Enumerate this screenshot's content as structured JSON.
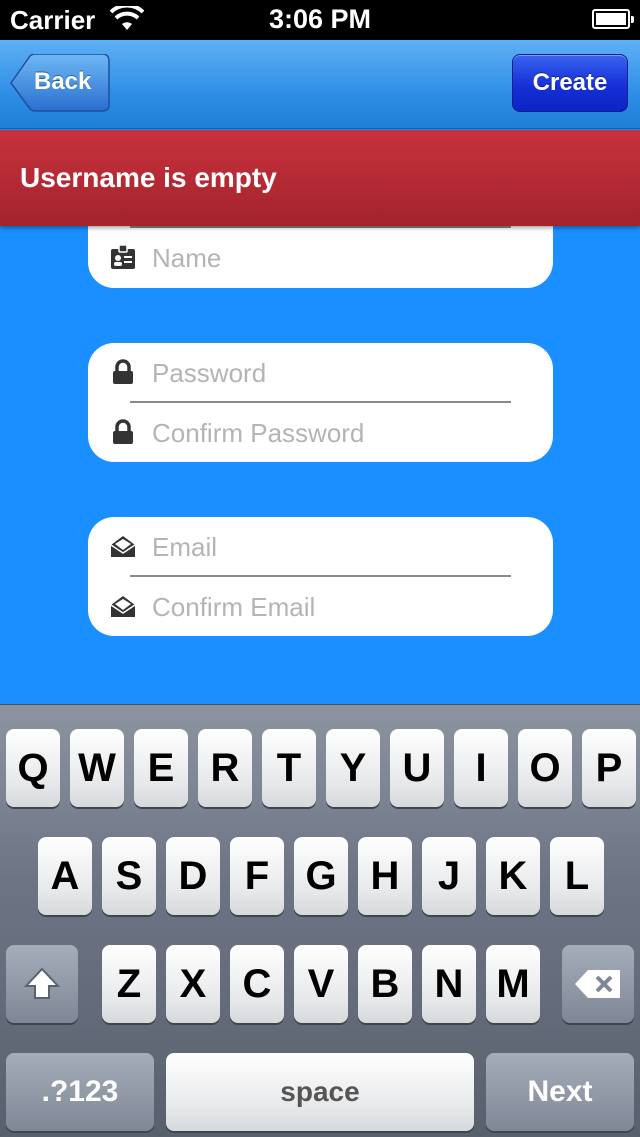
{
  "status_bar": {
    "carrier": "Carrier",
    "time": "3:06 PM"
  },
  "nav": {
    "back_label": "Back",
    "create_label": "Create"
  },
  "alert": {
    "message": "Username is empty"
  },
  "form": {
    "name": {
      "placeholder": "Name",
      "icon": "id-card-icon"
    },
    "password": {
      "placeholder": "Password",
      "icon": "lock-icon"
    },
    "confirm_password": {
      "placeholder": "Confirm Password",
      "icon": "lock-icon"
    },
    "email": {
      "placeholder": "Email",
      "icon": "envelope-icon"
    },
    "confirm_email": {
      "placeholder": "Confirm Email",
      "icon": "envelope-icon"
    }
  },
  "keyboard": {
    "row1": [
      "Q",
      "W",
      "E",
      "R",
      "T",
      "Y",
      "U",
      "I",
      "O",
      "P"
    ],
    "row2": [
      "A",
      "S",
      "D",
      "F",
      "G",
      "H",
      "J",
      "K",
      "L"
    ],
    "row3": [
      "Z",
      "X",
      "C",
      "V",
      "B",
      "N",
      "M"
    ],
    "numbers_label": ".?123",
    "space_label": "space",
    "next_label": "Next"
  },
  "colors": {
    "background": "#1a8fff",
    "alert": "#b52a33",
    "create_button": "#1530d6"
  }
}
